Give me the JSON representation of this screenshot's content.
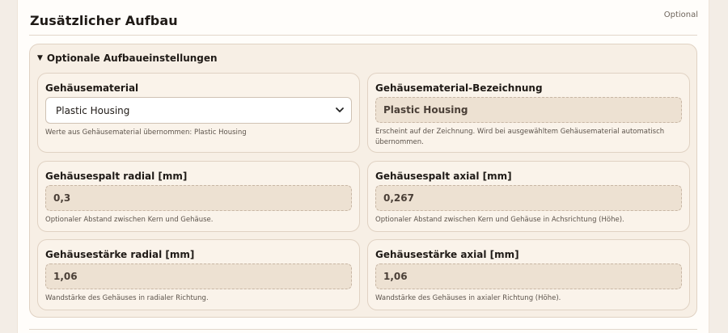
{
  "section": {
    "title": "Zusätzlicher Aufbau",
    "optional_tag": "Optional"
  },
  "details": {
    "summary": "Optionale Aufbaueinstellungen",
    "expanded": true
  },
  "fields": {
    "housing_material": {
      "label": "Gehäusematerial",
      "value": "Plastic Housing",
      "hint": "Werte aus Gehäusematerial übernommen: Plastic Housing"
    },
    "housing_material_name": {
      "label": "Gehäusematerial-Bezeichnung",
      "value": "Plastic Housing",
      "hint": "Erscheint auf der Zeichnung. Wird bei ausgewähltem Gehäusematerial automatisch übernommen."
    },
    "gap_radial": {
      "label": "Gehäusespalt radial [mm]",
      "value": "0,3",
      "hint": "Optionaler Abstand zwischen Kern und Gehäuse."
    },
    "gap_axial": {
      "label": "Gehäusespalt axial [mm]",
      "value": "0,267",
      "hint": "Optionaler Abstand zwischen Kern und Gehäuse in Achsrichtung (Höhe)."
    },
    "thickness_radial": {
      "label": "Gehäusestärke radial [mm]",
      "value": "1,06",
      "hint": "Wandstärke des Gehäuses in radialer Richtung."
    },
    "thickness_axial": {
      "label": "Gehäusestärke axial [mm]",
      "value": "1,06",
      "hint": "Wandstärke des Gehäuses in axialer Richtung (Höhe)."
    }
  },
  "colors": {
    "page_bg": "#f3ede6",
    "panel_bg": "#fffdfa",
    "group_bg": "#f7efe5",
    "card_bg": "#faf3ea",
    "readonly_field_bg": "#ede1d2",
    "border": "#e0d2c3"
  }
}
